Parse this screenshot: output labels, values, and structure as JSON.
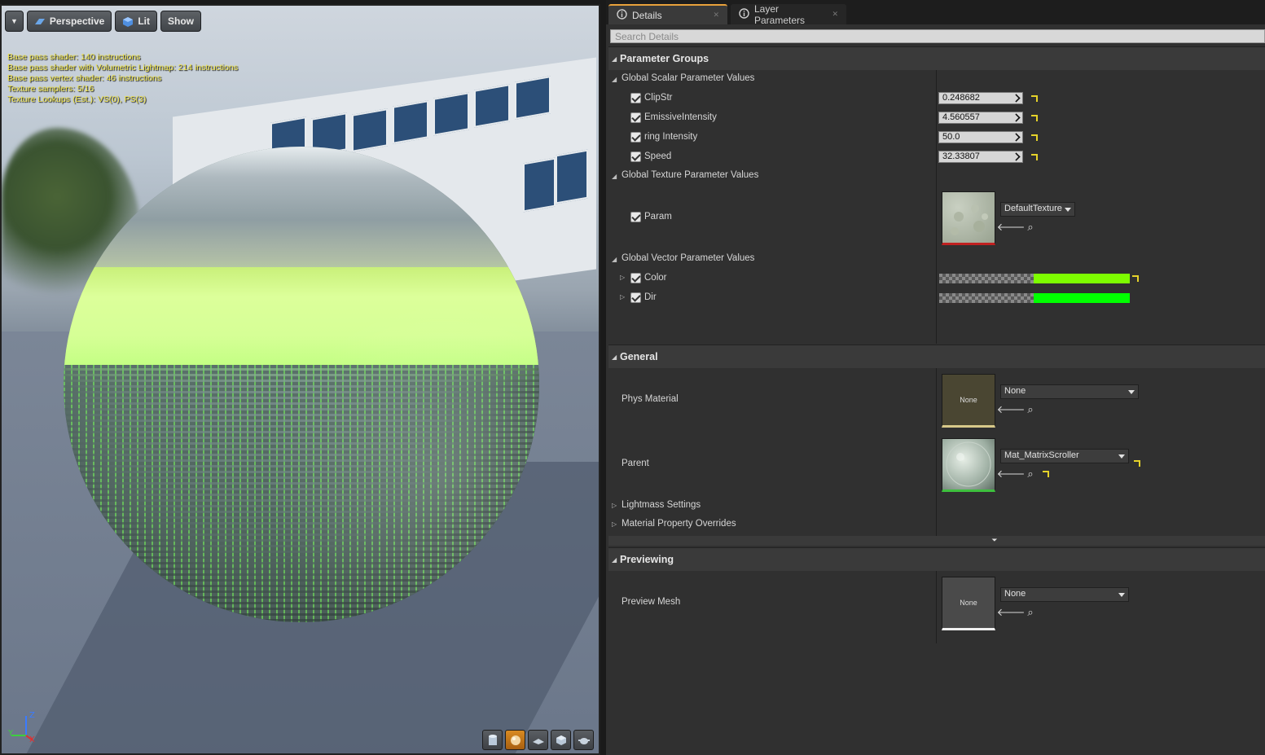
{
  "viewport": {
    "toolbar": {
      "menu_arrow": "▼",
      "perspective_label": "Perspective",
      "lit_label": "Lit",
      "show_label": "Show"
    },
    "stats": [
      "Base pass shader: 140 instructions",
      "Base pass shader with Volumetric Lightmap: 214 instructions",
      "Base pass vertex shader: 46 instructions",
      "Texture samplers: 5/16",
      "Texture Lookups (Est.): VS(0), PS(3)"
    ],
    "axis": {
      "z": "Z",
      "y": "Y",
      "x": "X"
    },
    "bottom_icons": [
      "cylinder-icon",
      "sphere-icon",
      "plane-icon",
      "cube-icon",
      "teapot-icon"
    ]
  },
  "panel": {
    "tabs": [
      {
        "label": "Details",
        "active": true
      },
      {
        "label": "Layer Parameters",
        "active": false
      }
    ],
    "search_placeholder": "Search Details",
    "parameter_groups": {
      "title": "Parameter Groups",
      "scalar_group": "Global Scalar Parameter Values",
      "scalars": [
        {
          "name": "ClipStr",
          "value": "0.248682"
        },
        {
          "name": "EmissiveIntensity",
          "value": "4.560557"
        },
        {
          "name": "ring Intensity",
          "value": "50.0"
        },
        {
          "name": "Speed",
          "value": "32.33807"
        }
      ],
      "texture_group": "Global Texture Parameter Values",
      "texture_param": {
        "name": "Param",
        "asset": "DefaultTexture"
      },
      "vector_group": "Global Vector Parameter Values",
      "vectors": [
        {
          "name": "Color",
          "color": "#7dfc00"
        },
        {
          "name": "Dir",
          "color": "#00ff00"
        }
      ]
    },
    "general": {
      "title": "General",
      "phys_material": {
        "label": "Phys Material",
        "thumb_text": "None",
        "asset": "None"
      },
      "parent": {
        "label": "Parent",
        "asset": "Mat_MatrixScroller"
      },
      "lightmass": "Lightmass Settings",
      "overrides": "Material Property Overrides"
    },
    "previewing": {
      "title": "Previewing",
      "preview_mesh": {
        "label": "Preview Mesh",
        "thumb_text": "None",
        "asset": "None"
      }
    },
    "colors": {
      "accent": "#e8a13b",
      "reset": "#e5d22a"
    }
  }
}
